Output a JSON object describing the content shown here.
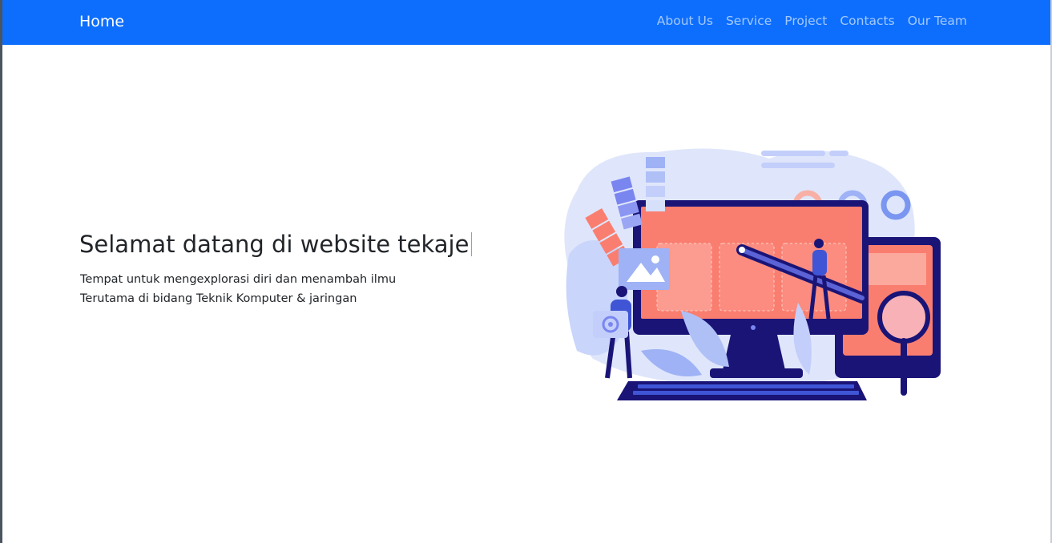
{
  "navbar": {
    "brand": "Home",
    "links": [
      "About Us",
      "Service",
      "Project",
      "Contacts",
      "Our Team"
    ],
    "bg_color": "#0d6efd"
  },
  "hero": {
    "title": "Selamat datang di website tekaje",
    "lines": [
      "Tempat untuk mengexplorasi diri dan menambah ilmu",
      "Terutama di bidang Teknik Komputer & jaringan"
    ]
  },
  "illustration": {
    "icons": [
      "computer-monitor-icon",
      "color-palette-icon",
      "image-icon",
      "gear-icon",
      "magnifier-icon",
      "pencil-icon",
      "keyboard-icon",
      "tablet-icon",
      "donut-chart-icon"
    ],
    "colors": {
      "primary": "#1a1477",
      "accent": "#fa7e6f",
      "light": "#d6e0fb",
      "mid": "#7a86f0"
    }
  }
}
